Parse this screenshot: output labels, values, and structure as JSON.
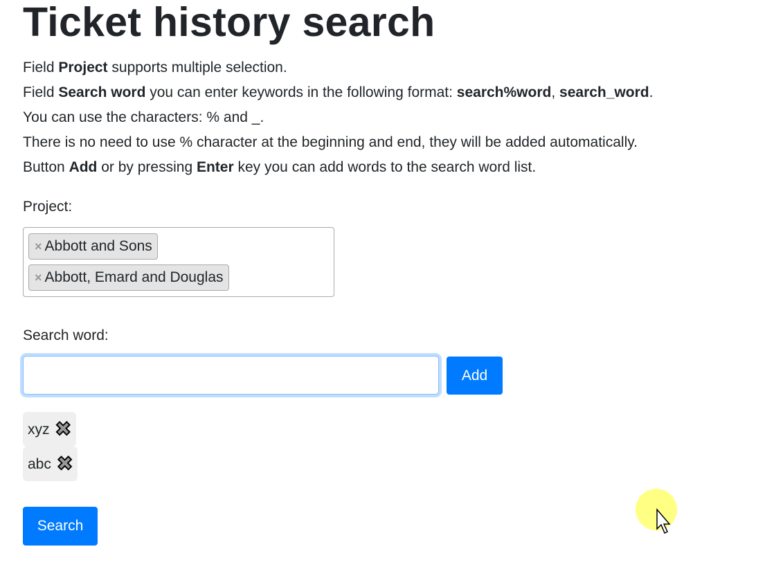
{
  "title": "Ticket history search",
  "info": [
    {
      "a": "Field ",
      "b": "Project",
      "c": " supports multiple selection.",
      "d": "",
      "e": "",
      "f": "",
      "g": ""
    },
    {
      "a": "Field ",
      "b": "Search word",
      "c": " you can enter keywords in the following format: ",
      "d": "search%word",
      "e": ", ",
      "f": "search_word",
      "g": "."
    },
    {
      "a": "You can use the characters: % and _.",
      "b": "",
      "c": "",
      "d": "",
      "e": "",
      "f": "",
      "g": ""
    },
    {
      "a": "There is no need to use % character at the beginning and end, they will be added automatically.",
      "b": "",
      "c": "",
      "d": "",
      "e": "",
      "f": "",
      "g": ""
    },
    {
      "a": "Button ",
      "b": "Add",
      "c": " or by pressing ",
      "d": "Enter",
      "e": " key you can add words to the search word list.",
      "f": "",
      "g": ""
    }
  ],
  "project": {
    "label": "Project:",
    "selected": [
      "Abbott and Sons",
      "Abbott, Emard and Douglas"
    ],
    "remove_glyph": "×"
  },
  "search_word": {
    "label": "Search word:",
    "value": "",
    "add_label": "Add",
    "words": [
      "xyz",
      "abc"
    ],
    "remove_glyph": "✖"
  },
  "search_label": "Search",
  "colors": {
    "primary": "#007bff"
  }
}
